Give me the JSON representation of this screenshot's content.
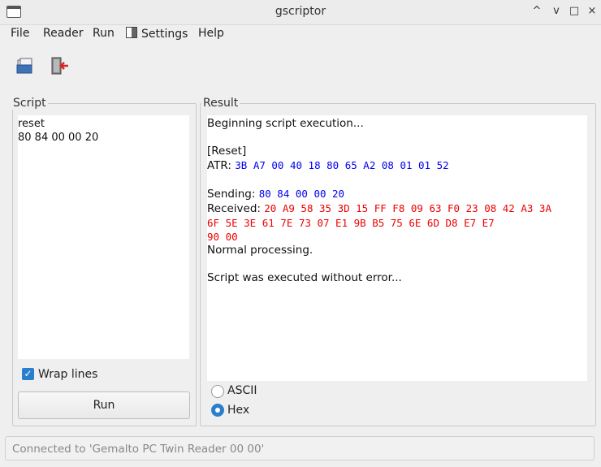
{
  "window": {
    "title": "gscriptor",
    "controls": [
      "^",
      "v",
      "□",
      "×"
    ]
  },
  "menu": [
    "File",
    "Reader",
    "Run",
    "Settings",
    "Help"
  ],
  "toolbar": {
    "open_icon": "open-folder-icon",
    "exit_icon": "exit-icon"
  },
  "script_panel": {
    "label": "Script",
    "lines": [
      "reset",
      "80 84 00 00 20"
    ],
    "wrap_label": "Wrap lines",
    "wrap_checked": true,
    "run_label": "Run"
  },
  "result_panel": {
    "label": "Result",
    "line1": "Beginning script execution...",
    "reset": "[Reset]",
    "atr_label": "ATR: ",
    "atr_value": "3B A7 00 40 18 80 65 A2 08 01 01 52",
    "sending_label": "Sending: ",
    "sending_value": "80 84 00 00 20",
    "received_label": "Received: ",
    "received_line1": "20 A9 58 35 3D 15 FF F8 09 63 F0 23 08 42 A3 3A",
    "received_line2": "6F 5E 3E 61 7E 73 07 E1 9B B5 75 6E 6D D8 E7 E7",
    "received_line3": "90 00",
    "normal": "Normal processing.",
    "done": "Script was executed without error...",
    "ascii_label": "ASCII",
    "hex_label": "Hex",
    "selected_mode": "Hex"
  },
  "status": "Connected to 'Gemalto PC Twin Reader 00 00'"
}
